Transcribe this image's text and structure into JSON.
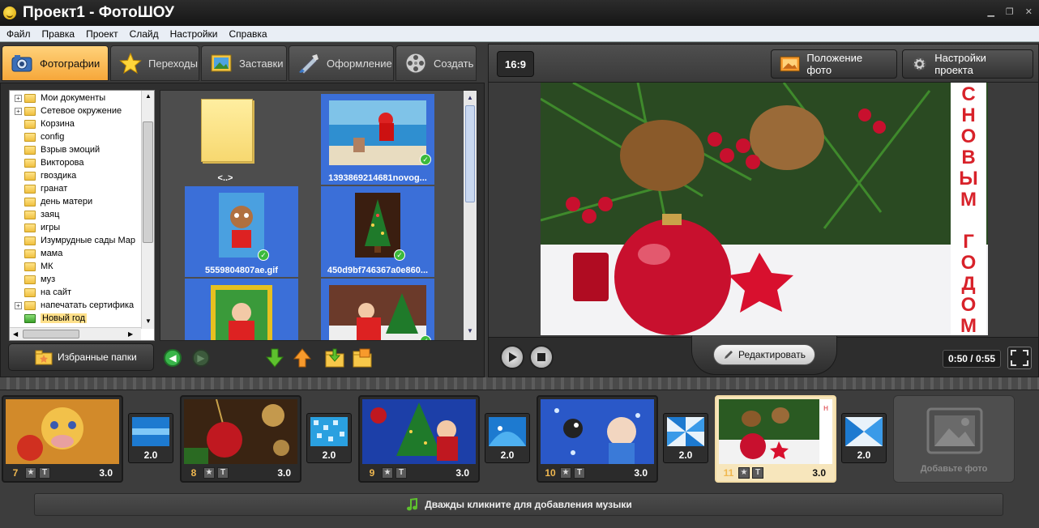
{
  "window": {
    "title": "Проект1 - ФотоШОУ"
  },
  "menu": [
    "Файл",
    "Правка",
    "Проект",
    "Слайд",
    "Настройки",
    "Справка"
  ],
  "tabs": [
    {
      "label": "Фотографии",
      "icon": "camera-icon",
      "active": true
    },
    {
      "label": "Переходы",
      "icon": "star-icon"
    },
    {
      "label": "Заставки",
      "icon": "picture-icon"
    },
    {
      "label": "Оформление",
      "icon": "brush-icon"
    },
    {
      "label": "Создать",
      "icon": "film-reel-icon"
    }
  ],
  "tree": [
    {
      "label": "Мои документы",
      "expandable": true
    },
    {
      "label": "Сетевое окружение",
      "expandable": true
    },
    {
      "label": "Корзина"
    },
    {
      "label": "config"
    },
    {
      "label": "Взрыв эмоций"
    },
    {
      "label": "Викторова"
    },
    {
      "label": "гвоздика"
    },
    {
      "label": "гранат"
    },
    {
      "label": "день матери"
    },
    {
      "label": "заяц"
    },
    {
      "label": "игры"
    },
    {
      "label": "Изумрудные сады Мар"
    },
    {
      "label": "мама"
    },
    {
      "label": "МК"
    },
    {
      "label": "муз"
    },
    {
      "label": "на сайт"
    },
    {
      "label": "напечатать сертифика",
      "expandable": true
    },
    {
      "label": "Новый год",
      "selected": true
    }
  ],
  "thumbnails": [
    {
      "label": "<..>",
      "kind": "folder-up"
    },
    {
      "label": "1393869214681novog...",
      "kind": "photo",
      "checked": true
    },
    {
      "label": "5559804807ae.gif",
      "kind": "photo",
      "checked": true
    },
    {
      "label": "450d9bf746367a0e860...",
      "kind": "photo",
      "checked": true
    },
    {
      "label": "",
      "kind": "photo"
    },
    {
      "label": "",
      "kind": "photo",
      "checked": true
    }
  ],
  "favorites": {
    "label": "Избранные папки"
  },
  "header": {
    "ratio": "16:9",
    "photo_position": "Положение фото",
    "project_settings": "Настройки проекта"
  },
  "preview": {
    "vertical_text": [
      "С",
      "Н",
      "О",
      "В",
      "Ы",
      "М",
      "",
      "Г",
      "О",
      "Д",
      "О",
      "М"
    ]
  },
  "player": {
    "edit_label": "Редактировать",
    "time": "0:50 / 0:55"
  },
  "timeline": {
    "slides": [
      {
        "num": "7",
        "duration": "3.0"
      },
      {
        "num": "8",
        "duration": "3.0"
      },
      {
        "num": "9",
        "duration": "3.0"
      },
      {
        "num": "10",
        "duration": "3.0"
      },
      {
        "num": "11",
        "duration": "3.0",
        "selected": true
      }
    ],
    "transitions": [
      "2.0",
      "2.0",
      "2.0",
      "2.0",
      "2.0"
    ],
    "add_photo": "Добавьте фото",
    "music_hint": "Дважды кликните для добавления музыки",
    "star_glyph": "★",
    "text_glyph": "T"
  },
  "colors": {
    "accent": "#f6a73a",
    "selection": "#3b6fd8",
    "check": "#3cba3c"
  }
}
